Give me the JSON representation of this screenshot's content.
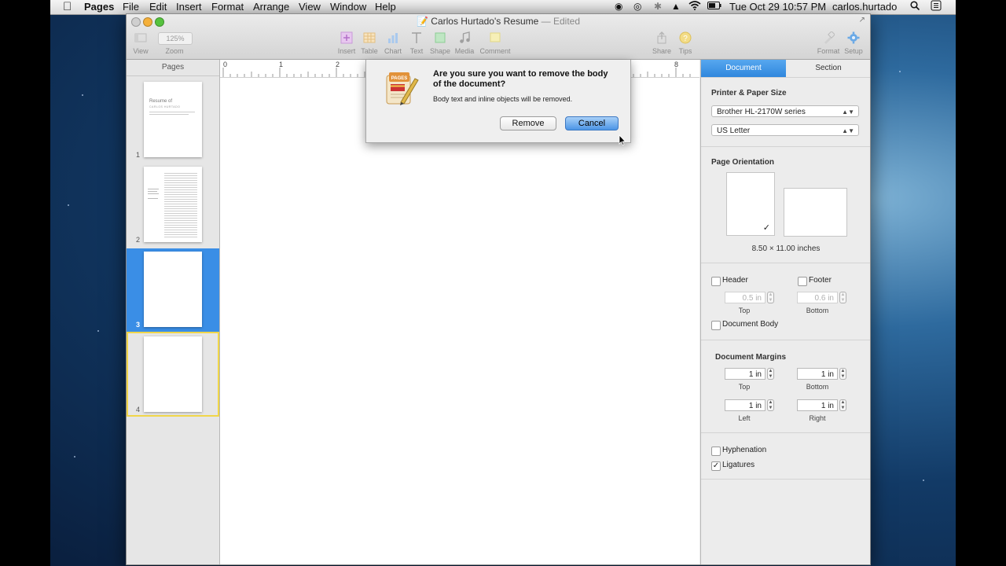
{
  "menubar": {
    "app": "Pages",
    "items": [
      "File",
      "Edit",
      "Insert",
      "Format",
      "Arrange",
      "View",
      "Window",
      "Help"
    ],
    "datetime": "Tue Oct 29  10:57 PM",
    "user": "carlos.hurtado"
  },
  "window": {
    "title": "Carlos Hurtado's Resume",
    "edited": "— Edited",
    "zoom": "125%"
  },
  "toolbar": {
    "view": "View",
    "zoom": "Zoom",
    "insert": "Insert",
    "table": "Table",
    "chart": "Chart",
    "text": "Text",
    "shape": "Shape",
    "media": "Media",
    "comment": "Comment",
    "share": "Share",
    "tips": "Tips",
    "format": "Format",
    "setup": "Setup"
  },
  "sidebar": {
    "header": "Pages",
    "pages": [
      {
        "number": "1",
        "title": "Resume of",
        "subtitle": "CARLOS HURTADO"
      },
      {
        "number": "2"
      },
      {
        "number": "3"
      },
      {
        "number": "4"
      }
    ]
  },
  "ruler": [
    "0",
    "1",
    "2",
    "8"
  ],
  "dialog": {
    "question": "Are you sure you want to remove the body of the document?",
    "detail": "Body text and inline objects will be removed.",
    "remove": "Remove",
    "cancel": "Cancel"
  },
  "inspector": {
    "tabs": [
      "Document",
      "Section"
    ],
    "printer_heading": "Printer & Paper Size",
    "printer": "Brother HL-2170W series",
    "paper": "US Letter",
    "orientation_heading": "Page Orientation",
    "dimensions": "8.50 × 11.00 inches",
    "header_label": "Header",
    "footer_label": "Footer",
    "header_value": "0.5 in",
    "footer_value": "0.6 in",
    "top_caption": "Top",
    "bottom_caption": "Bottom",
    "document_body": "Document Body",
    "margins_heading": "Document Margins",
    "margin_top": "1 in",
    "margin_bottom": "1 in",
    "margin_left": "1 in",
    "margin_right": "1 in",
    "left_caption": "Left",
    "right_caption": "Right",
    "hyphenation": "Hyphenation",
    "ligatures": "Ligatures",
    "check_mark": "✓"
  }
}
